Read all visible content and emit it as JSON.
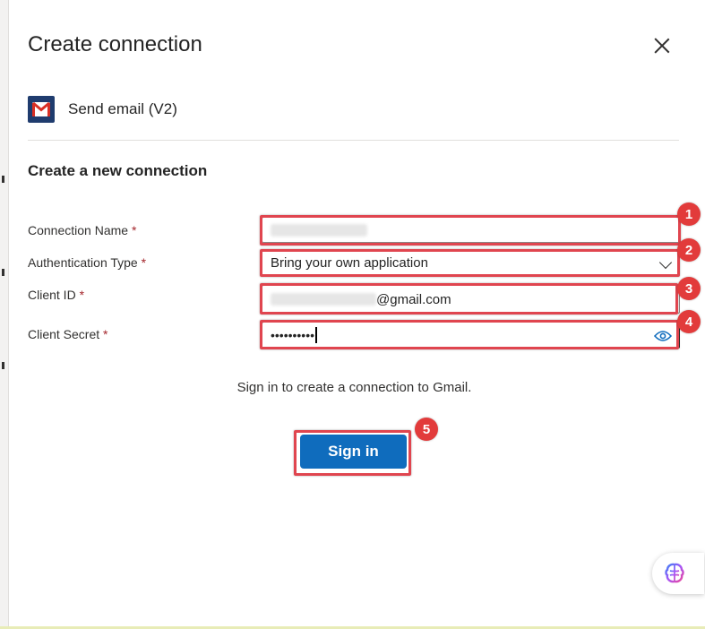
{
  "dialog": {
    "title": "Create connection",
    "action_name": "Send email (V2)",
    "action_icon": "gmail-icon",
    "section_title": "Create a new connection"
  },
  "form": {
    "connection_name": {
      "label": "Connection Name",
      "required_mark": "*",
      "value_redacted": true
    },
    "authentication_type": {
      "label": "Authentication Type",
      "required_mark": "*",
      "value": "Bring your own application"
    },
    "client_id": {
      "label": "Client ID",
      "required_mark": "*",
      "value_suffix": "@gmail.com",
      "value_prefix_redacted": true
    },
    "client_secret": {
      "label": "Client Secret",
      "required_mark": "*",
      "value_masked": "••••••••••"
    }
  },
  "info_text": "Sign in to create a connection to Gmail.",
  "sign_in_label": "Sign in",
  "annotations": [
    "1",
    "2",
    "3",
    "4",
    "5"
  ],
  "colors": {
    "primary": "#0f6cbd",
    "highlight": "#e0454f",
    "badge": "#e23b3b",
    "required": "#a4262c"
  }
}
